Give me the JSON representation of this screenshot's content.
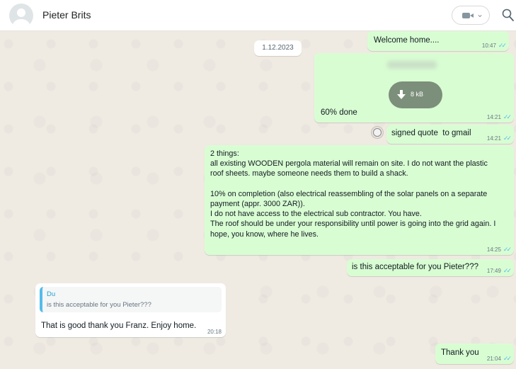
{
  "header": {
    "contact_name": "Pieter Brits",
    "call_button_icon": "video-camera-icon",
    "call_dropdown_icon": "chevron-down-icon",
    "search_icon": "search-icon"
  },
  "chat": {
    "date_separator": "1.12.2023",
    "messages": [
      {
        "direction": "out",
        "text": "Welcome home....",
        "time": "10:47",
        "status": "read"
      },
      {
        "direction": "out",
        "type": "file",
        "file_size": "8 kB",
        "caption": "60% done",
        "time": "14:21",
        "status": "read"
      },
      {
        "direction": "out",
        "text": "signed quote  to gmail",
        "time": "14:21",
        "status": "read",
        "reaction_icon": "smiley-icon"
      },
      {
        "direction": "out",
        "text": "2 things:\nall existing WOODEN pergola material will remain on site. I do not want the plastic roof sheets. maybe someone needs them to build a shack.\n\n10% on completion (also electrical reassembling of the solar panels on a separate payment (appr. 3000 ZAR)).\nI do not have access to the electrical sub contractor. You have.\nThe roof should be under your responsibility until power is going into the grid again.  I hope, you know, where he lives.",
        "time": "14:25",
        "status": "read"
      },
      {
        "direction": "out",
        "text": "is this acceptable for you Pieter???",
        "time": "17:49",
        "status": "read"
      },
      {
        "direction": "in",
        "quote_author": "Du",
        "quote_text": "is this acceptable for you Pieter???",
        "text": "That is good thank you Franz. Enjoy home.",
        "time": "20:18"
      },
      {
        "direction": "out",
        "text": "Thank you",
        "time": "21:04",
        "status": "read"
      }
    ]
  },
  "colors": {
    "outgoing_bubble": "#d9fdd3",
    "incoming_bubble": "#ffffff",
    "read_ticks": "#53bdeb",
    "chat_background": "#efeae2",
    "quote_accent": "#53bdeb"
  }
}
